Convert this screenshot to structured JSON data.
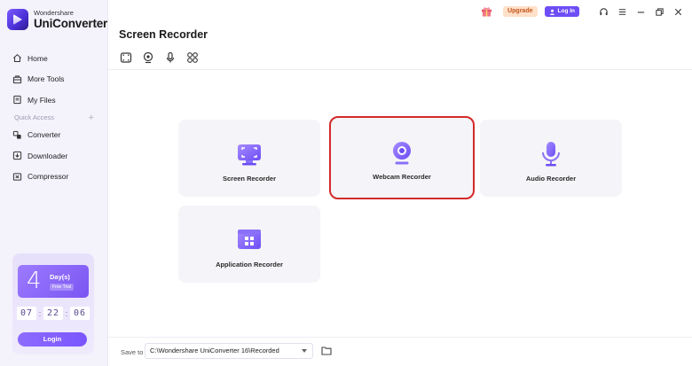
{
  "app": {
    "brand_small": "Wondershare",
    "brand_name": "UniConverter"
  },
  "sidebar": {
    "items": [
      {
        "label": "Home",
        "icon": "home-icon"
      },
      {
        "label": "More Tools",
        "icon": "toolbox-icon"
      },
      {
        "label": "My Files",
        "icon": "files-icon"
      }
    ],
    "quick_access_label": "Quick Access",
    "quick_items": [
      {
        "label": "Converter",
        "icon": "converter-icon"
      },
      {
        "label": "Downloader",
        "icon": "downloader-icon"
      },
      {
        "label": "Compressor",
        "icon": "compressor-icon"
      }
    ]
  },
  "trial": {
    "number": "4",
    "days_label": "Day(s)",
    "free_trial": "Free Trial",
    "hours": "07",
    "minutes": "22",
    "seconds": "06",
    "login_label": "Login"
  },
  "topbar": {
    "upgrade_label": "Upgrade",
    "login_label": "Log In"
  },
  "main": {
    "title": "Screen Recorder",
    "cards": [
      {
        "label": "Screen Recorder",
        "icon": "screen-recorder-icon"
      },
      {
        "label": "Webcam Recorder",
        "icon": "webcam-icon",
        "selected": true
      },
      {
        "label": "Audio Recorder",
        "icon": "microphone-icon"
      },
      {
        "label": "Application Recorder",
        "icon": "application-window-icon"
      }
    ]
  },
  "bottom": {
    "save_to_label": "Save to",
    "save_path": "C:\\Wondershare UniConverter 16\\Recorded"
  },
  "colors": {
    "accent": "#6d4df5",
    "selection_outline": "#d42a2a",
    "upgrade_bg": "#ffe0c9"
  }
}
